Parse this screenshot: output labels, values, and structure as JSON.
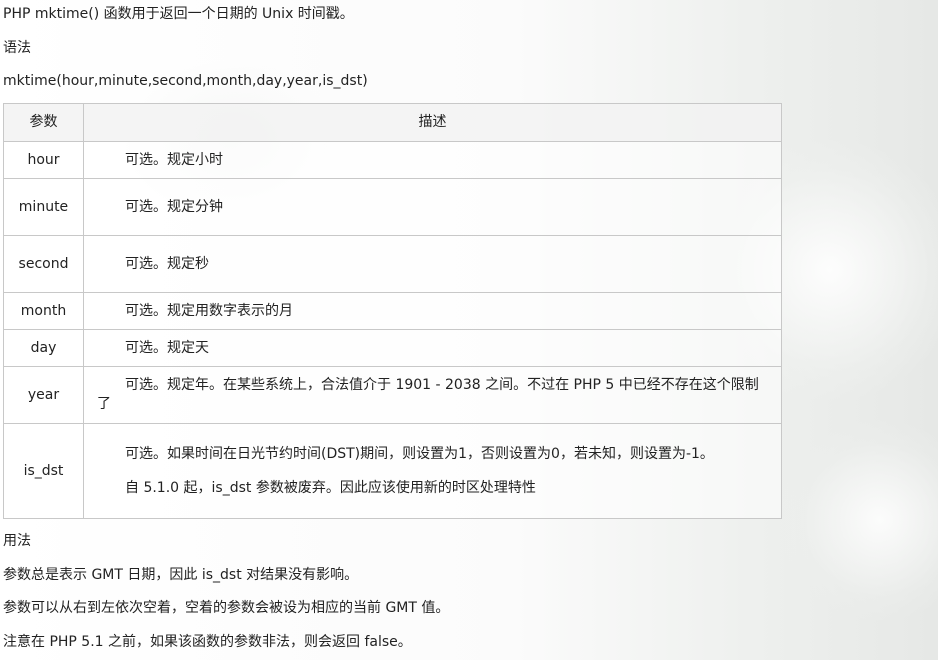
{
  "intro": "PHP mktime() 函数用于返回一个日期的 Unix 时间戳。",
  "syntax_heading": "语法",
  "syntax": "mktime(hour,minute,second,month,day,year,is_dst)",
  "table": {
    "headers": [
      "参数",
      "描述"
    ],
    "rows": [
      {
        "name": "hour",
        "desc": [
          "可选。规定小时"
        ]
      },
      {
        "name": "minute",
        "desc": [
          "可选。规定分钟"
        ]
      },
      {
        "name": "second",
        "desc": [
          "可选。规定秒"
        ]
      },
      {
        "name": "month",
        "desc": [
          "可选。规定用数字表示的月"
        ]
      },
      {
        "name": "day",
        "desc": [
          "可选。规定天"
        ]
      },
      {
        "name": "year",
        "desc": [
          "可选。规定年。在某些系统上，合法值介于 1901 - 2038 之间。不过在 PHP 5 中已经不存在这个限制了"
        ]
      },
      {
        "name": "is_dst",
        "desc": [
          "可选。如果时间在日光节约时间(DST)期间，则设置为1，否则设置为0，若未知，则设置为-1。",
          "自 5.1.0 起，is_dst 参数被废弃。因此应该使用新的时区处理特性"
        ]
      }
    ]
  },
  "usage_heading": "用法",
  "usage": [
    "参数总是表示 GMT 日期，因此 is_dst 对结果没有影响。",
    "参数可以从右到左依次空着，空着的参数会被设为相应的当前 GMT 值。",
    "注意在 PHP 5.1 之前，如果该函数的参数非法，则会返回 false。"
  ]
}
